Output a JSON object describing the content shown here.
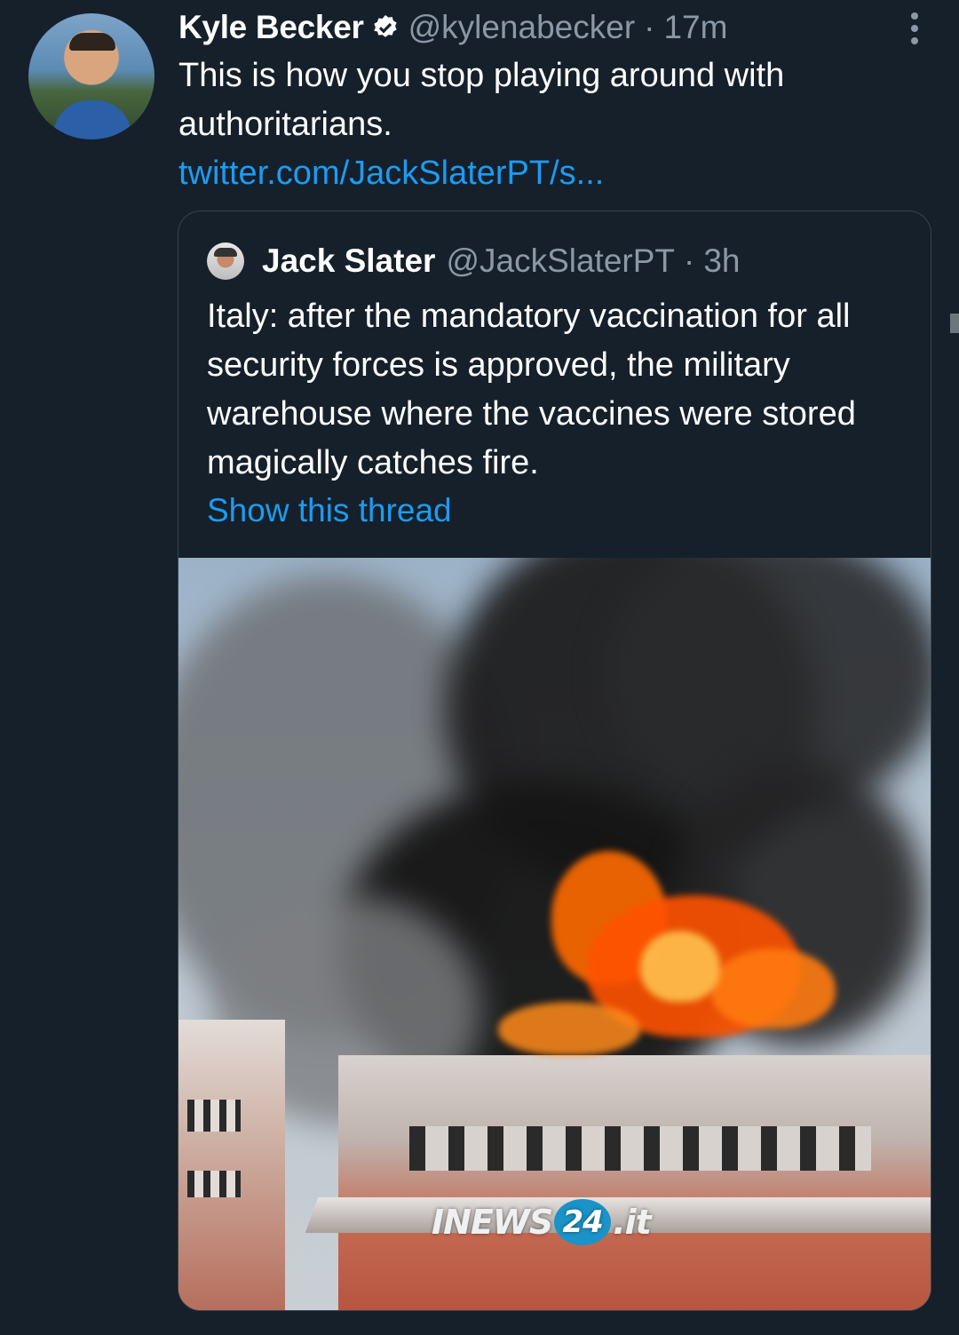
{
  "tweet": {
    "author_name": "Kyle Becker",
    "handle": "@kylenabecker",
    "separator": "·",
    "time": "17m",
    "text": "This is how you stop playing around with authoritarians.",
    "link": "twitter.com/JackSlaterPT/s..."
  },
  "quoted": {
    "author_name": "Jack Slater",
    "handle": "@JackSlaterPT",
    "separator": "·",
    "time": "3h",
    "text": "Italy: after the mandatory vaccination for all security forces is approved, the military warehouse where the vaccines were stored magically catches fire.",
    "show_thread": "Show this thread",
    "media_watermark": {
      "prefix": "INEWS",
      "badge": "24",
      "suffix": ".it"
    }
  },
  "icons": {
    "verified": "verified-badge-icon",
    "more": "more-options-icon"
  },
  "colors": {
    "background": "#15202b",
    "link": "#1d9bf0",
    "secondary_text": "#8b98a5",
    "border": "#38444d"
  }
}
